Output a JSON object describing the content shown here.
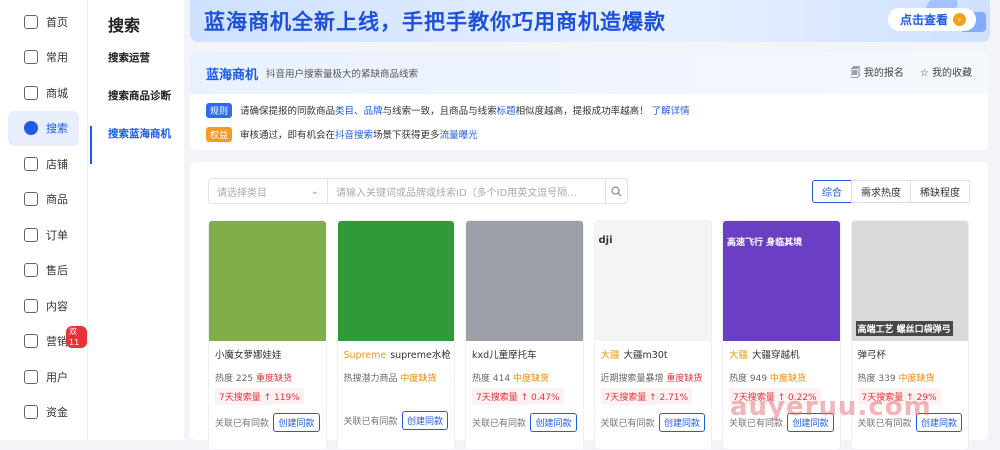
{
  "nav": {
    "items": [
      {
        "label": "首页",
        "icon": "home-icon"
      },
      {
        "label": "常用",
        "icon": "folder-icon"
      },
      {
        "label": "商城",
        "icon": "store-icon"
      },
      {
        "label": "搜索",
        "icon": "search-icon"
      },
      {
        "label": "店铺",
        "icon": "shop-icon"
      },
      {
        "label": "商品",
        "icon": "box-icon"
      },
      {
        "label": "订单",
        "icon": "order-icon"
      },
      {
        "label": "售后",
        "icon": "aftersale-icon"
      },
      {
        "label": "内容",
        "icon": "content-icon"
      },
      {
        "label": "营销",
        "icon": "marketing-icon"
      },
      {
        "label": "用户",
        "icon": "user-icon"
      },
      {
        "label": "资金",
        "icon": "wallet-icon"
      }
    ],
    "marketing_badge": "双11"
  },
  "subnav": {
    "title": "搜索",
    "items": [
      "搜索运营",
      "搜索商品诊断",
      "搜索蓝海商机"
    ]
  },
  "banner": {
    "text": "蓝海商机全新上线，手把手教你巧用商机造爆款",
    "button": "点击查看"
  },
  "info": {
    "title": "蓝海商机",
    "subtitle": "抖音用户搜索量极大的紧缺商品线索",
    "my_signup": "我的报名",
    "my_favorites": "我的收藏",
    "rule_tag": "规则",
    "rule_text_1": "请确保提报的同款商品",
    "rule_hl_1": "类目",
    "rule_text_2": "、",
    "rule_hl_2": "品牌",
    "rule_text_3": "与线索一致，且商品与线索",
    "rule_hl_3": "标题",
    "rule_text_4": "相似度越高，提报成功率越高！",
    "rule_link": "了解详情",
    "benefit_tag": "权益",
    "benefit_text_1": "审核通过，即有机会在",
    "benefit_hl_1": "抖音搜索",
    "benefit_text_2": "场景下获得更多",
    "benefit_hl_2": "流量曝光"
  },
  "filters": {
    "category_placeholder": "请选择类目",
    "search_placeholder": "请输入关键词或品牌或线索ID（多个ID用英文逗号隔..."
  },
  "sorts": [
    "综合",
    "需求热度",
    "稀缺程度"
  ],
  "cards": [
    {
      "brand": "",
      "title": "小魔女萝娜娃娃",
      "heat_label": "热度",
      "heat": "225",
      "lack": "重度缺货",
      "lack_level": "red",
      "stat": "7天搜索量 ↑ 119%",
      "linked": "关联已有同款",
      "create": "创建同款",
      "bg": "#7fae4a"
    },
    {
      "brand": "Supreme",
      "title": "supreme水枪",
      "heat_label": "",
      "heat": "",
      "lack_prefix": "热搜潜力商品",
      "lack": "中度缺货",
      "lack_level": "orange",
      "stat": "",
      "linked": "关联已有同款",
      "create": "创建同款",
      "bg": "#2f9a3a"
    },
    {
      "brand": "",
      "title": "kxd儿童摩托车",
      "heat_label": "热度",
      "heat": "414",
      "lack": "中度缺货",
      "lack_level": "orange",
      "stat": "7天搜索量 ↑ 0.47%",
      "linked": "关联已有同款",
      "create": "创建同款",
      "bg": "#9aa0a6"
    },
    {
      "brand": "大疆",
      "title": "大疆m30t",
      "heat_label": "",
      "heat": "",
      "lack_prefix": "近期搜索量暴增",
      "lack": "重度缺货",
      "lack_level": "red",
      "stat": "7天搜索量 ↑ 2.71%",
      "linked": "关联已有同款",
      "create": "创建同款",
      "bg": "#f4f4f6",
      "top_text": "dji"
    },
    {
      "brand": "大疆",
      "title": "大疆穿越机",
      "heat_label": "热度",
      "heat": "949",
      "lack": "中度缺货",
      "lack_level": "orange",
      "stat": "7天搜索量 ↑ 0.22%",
      "linked": "关联已有同款",
      "create": "创建同款",
      "bg": "#6b3fc4",
      "top_text": "高速飞行 身临其境"
    },
    {
      "brand": "",
      "title": "弹弓杯",
      "heat_label": "热度",
      "heat": "339",
      "lack": "中度缺货",
      "lack_level": "orange",
      "stat": "7天搜索量 ↑ 29%",
      "linked": "关联已有同款",
      "create": "创建同款",
      "bg": "#d9d9d9",
      "top_text": "高端工艺 螺丝口袋弹弓"
    }
  ],
  "watermark": "auyeruu.com"
}
